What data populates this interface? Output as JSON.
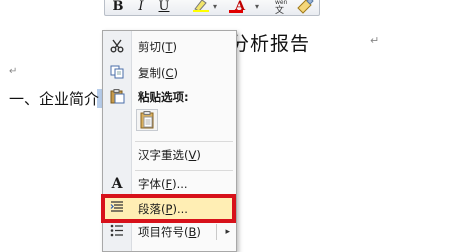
{
  "toolbar": {
    "bold": "B",
    "italic": "I",
    "underline": "U",
    "font_color": "A",
    "phonetic": "wén",
    "dropdown": "▾",
    "font_color_bar": "#e00000"
  },
  "document": {
    "title": "…………业投资分析报告",
    "title_visible": "业投资分析报告",
    "title_prefix_hidden": "企业投资分析报告",
    "paragraph_mark": "↵",
    "heading": "一、企业简介",
    "selection_color": "#b7cdea"
  },
  "menu": {
    "cut": {
      "label": "剪切",
      "key": "T",
      "icon": "scissors-icon"
    },
    "copy": {
      "label": "复制",
      "key": "C",
      "icon": "copy-icon"
    },
    "paste_options": {
      "label": "粘贴选项:",
      "icon": "paste-icon"
    },
    "hanzi_reselect": {
      "label": "汉字重选",
      "key": "V"
    },
    "font": {
      "label": "字体",
      "key": "F",
      "suffix": "...",
      "icon": "font-icon"
    },
    "paragraph": {
      "label": "段落",
      "key": "P",
      "suffix": "...",
      "icon": "paragraph-icon"
    },
    "bullets": {
      "label": "项目符号",
      "key": "B",
      "icon": "bullets-icon"
    },
    "submenu_arrow": "▸",
    "highlight_color": "#d7111a"
  }
}
